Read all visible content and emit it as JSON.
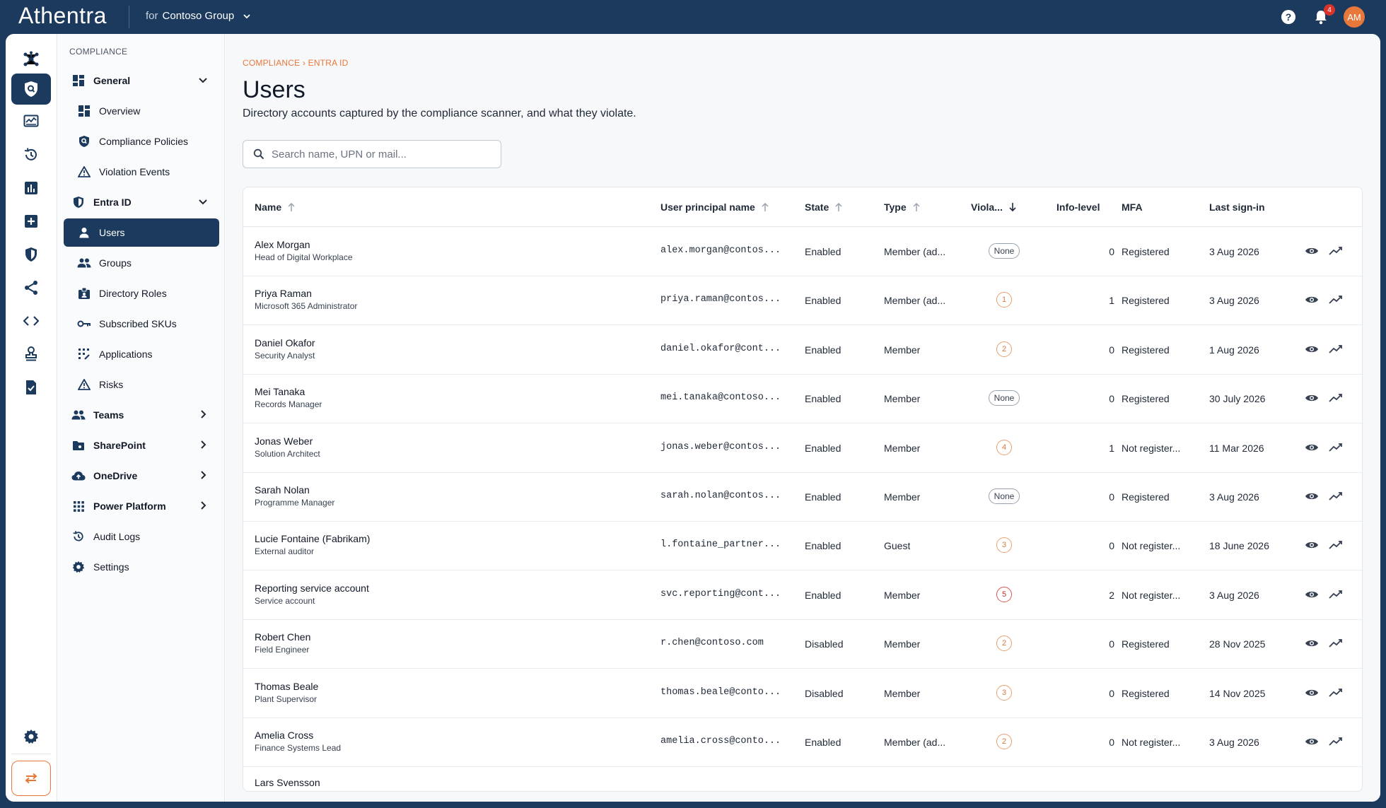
{
  "app": {
    "brand": "Athentra",
    "org_prefix": "for",
    "org_name": "Contoso Group",
    "notification_count": "4",
    "user_initials": "AM"
  },
  "colors": {
    "navy": "#1c3a5e",
    "accent": "#e8773a"
  },
  "rail_icons": [
    "hub-icon",
    "compliance-shield-icon",
    "monitor-icon",
    "history-icon",
    "chart-icon",
    "add-box-icon",
    "shield-icon",
    "share-icon",
    "code-icon",
    "stamp-icon",
    "checklist-icon"
  ],
  "subnav": {
    "heading": "COMPLIANCE",
    "general": {
      "label": "General",
      "items": [
        "Overview",
        "Compliance Policies",
        "Violation Events"
      ]
    },
    "entra": {
      "label": "Entra ID",
      "items": [
        "Users",
        "Groups",
        "Directory Roles",
        "Subscribed SKUs",
        "Applications",
        "Risks"
      ]
    },
    "teams": "Teams",
    "sharepoint": "SharePoint",
    "onedrive": "OneDrive",
    "power_platform": "Power Platform",
    "audit_logs": "Audit Logs",
    "settings": "Settings"
  },
  "page": {
    "breadcrumb": "COMPLIANCE › ENTRA ID",
    "title": "Users",
    "subtitle": "Directory accounts captured by the compliance scanner, and what they violate.",
    "search_placeholder": "Search name, UPN or mail..."
  },
  "table": {
    "columns": {
      "name": "Name",
      "upn": "User principal name",
      "state": "State",
      "type": "Type",
      "violations": "Viola...",
      "info": "Info-level",
      "mfa": "MFA",
      "last": "Last sign-in"
    },
    "rows": [
      {
        "name": "Alex Morgan",
        "title": "Head of Digital Workplace",
        "upn": "alex.morgan@contos...",
        "state": "Enabled",
        "type": "Member (ad...",
        "violations": "None",
        "info": "0",
        "mfa": "Registered",
        "last": "3 Aug 2026"
      },
      {
        "name": "Priya Raman",
        "title": "Microsoft 365 Administrator",
        "upn": "priya.raman@contos...",
        "state": "Enabled",
        "type": "Member (ad...",
        "violations": "1",
        "info": "1",
        "mfa": "Registered",
        "last": "3 Aug 2026"
      },
      {
        "name": "Daniel Okafor",
        "title": "Security Analyst",
        "upn": "daniel.okafor@cont...",
        "state": "Enabled",
        "type": "Member",
        "violations": "2",
        "info": "0",
        "mfa": "Registered",
        "last": "1 Aug 2026"
      },
      {
        "name": "Mei Tanaka",
        "title": "Records Manager",
        "upn": "mei.tanaka@contoso...",
        "state": "Enabled",
        "type": "Member",
        "violations": "None",
        "info": "0",
        "mfa": "Registered",
        "last": "30 July 2026"
      },
      {
        "name": "Jonas Weber",
        "title": "Solution Architect",
        "upn": "jonas.weber@contos...",
        "state": "Enabled",
        "type": "Member",
        "violations": "4",
        "info": "1",
        "mfa": "Not register...",
        "last": "11 Mar 2026"
      },
      {
        "name": "Sarah Nolan",
        "title": "Programme Manager",
        "upn": "sarah.nolan@contos...",
        "state": "Enabled",
        "type": "Member",
        "violations": "None",
        "info": "0",
        "mfa": "Registered",
        "last": "3 Aug 2026"
      },
      {
        "name": "Lucie Fontaine (Fabrikam)",
        "title": "External auditor",
        "upn": "l.fontaine_partner...",
        "state": "Enabled",
        "type": "Guest",
        "violations": "3",
        "info": "0",
        "mfa": "Not register...",
        "last": "18 June 2026"
      },
      {
        "name": "Reporting service account",
        "title": "Service account",
        "upn": "svc.reporting@cont...",
        "state": "Enabled",
        "type": "Member",
        "violations": "5",
        "info": "2",
        "mfa": "Not register...",
        "last": "3 Aug 2026"
      },
      {
        "name": "Robert Chen",
        "title": "Field Engineer",
        "upn": "r.chen@contoso.com",
        "state": "Disabled",
        "type": "Member",
        "violations": "2",
        "info": "0",
        "mfa": "Registered",
        "last": "28 Nov 2025"
      },
      {
        "name": "Thomas Beale",
        "title": "Plant Supervisor",
        "upn": "thomas.beale@conto...",
        "state": "Disabled",
        "type": "Member",
        "violations": "3",
        "info": "0",
        "mfa": "Registered",
        "last": "14 Nov 2025"
      },
      {
        "name": "Amelia Cross",
        "title": "Finance Systems Lead",
        "upn": "amelia.cross@conto...",
        "state": "Enabled",
        "type": "Member (ad...",
        "violations": "2",
        "info": "0",
        "mfa": "Not register...",
        "last": "3 Aug 2026"
      }
    ],
    "partial_row_name": "Lars Svensson"
  }
}
